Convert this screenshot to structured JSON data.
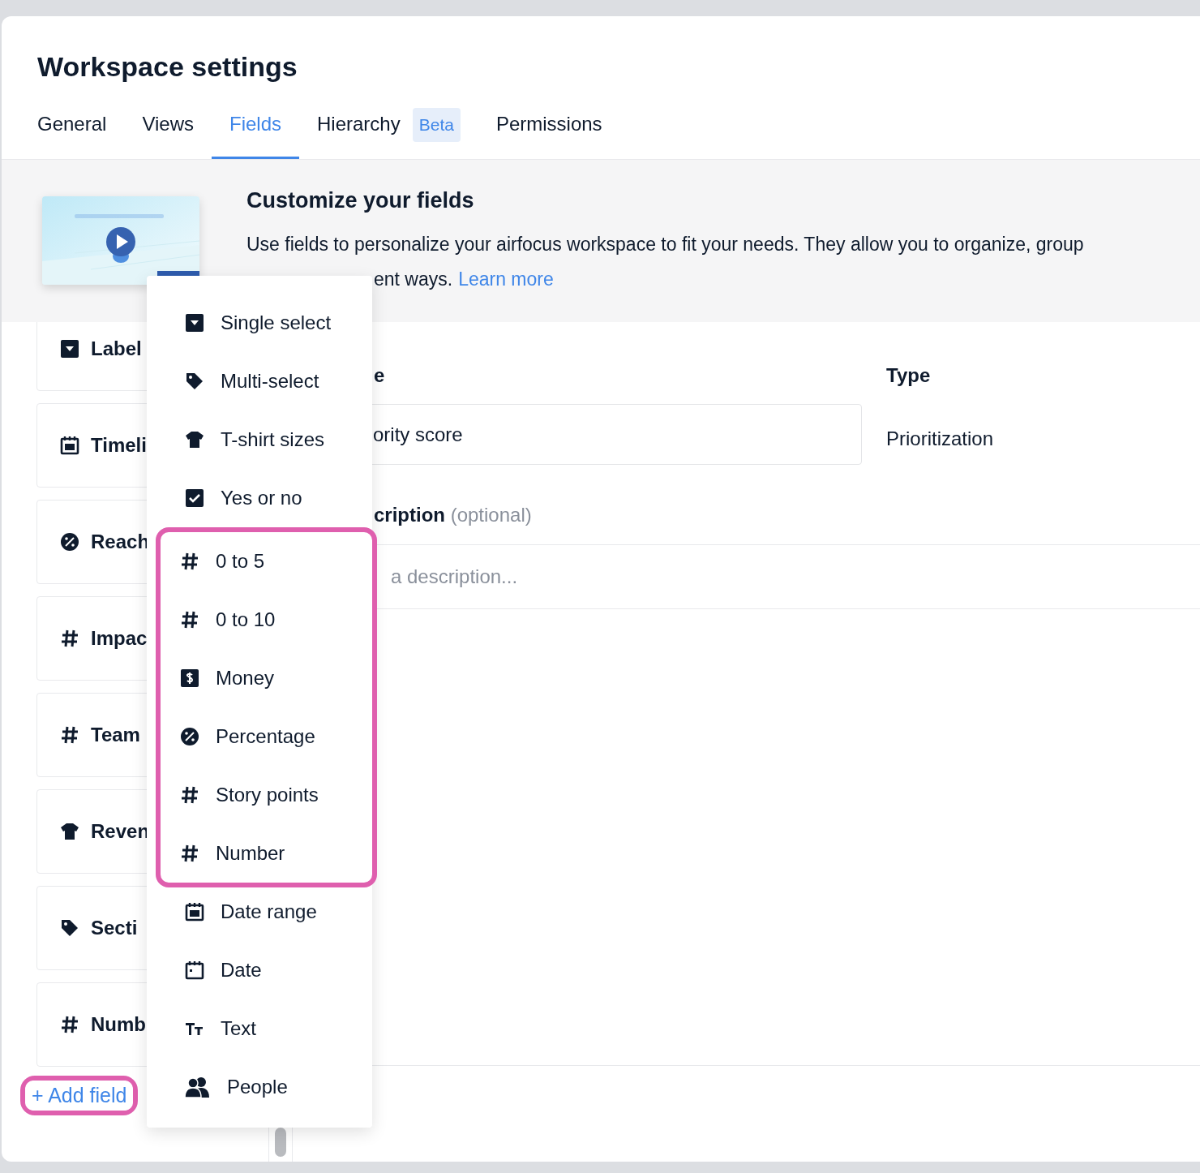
{
  "header": {
    "title": "Workspace settings"
  },
  "tabs": [
    {
      "label": "General",
      "selected": false
    },
    {
      "label": "Views",
      "selected": false
    },
    {
      "label": "Fields",
      "selected": true
    },
    {
      "label": "Hierarchy",
      "selected": false,
      "badge": "Beta"
    },
    {
      "label": "Permissions",
      "selected": false
    }
  ],
  "intro": {
    "title": "Customize your fields",
    "text_line_1": "Use fields to personalize your airfocus workspace to fit your needs. They allow you to organize, group",
    "text_line_2": "ent ways.",
    "link": "Learn more"
  },
  "field_list": [
    {
      "name": "Label",
      "kind": "select"
    },
    {
      "name": "Timeli",
      "kind": "daterange"
    },
    {
      "name": "Reach",
      "kind": "percent"
    },
    {
      "name": "Impac",
      "kind": "number"
    },
    {
      "name": "Team",
      "kind": "number"
    },
    {
      "name": "Reven",
      "kind": "tshirt"
    },
    {
      "name": "Secti",
      "kind": "tag"
    },
    {
      "name": "Numb",
      "kind": "number"
    }
  ],
  "add_field": {
    "label": "+ Add field",
    "highlighted": true
  },
  "editor": {
    "name_label": "e",
    "name_value": "ority score",
    "type_label": "Type",
    "type_value": "Prioritization",
    "description_label": "cription",
    "description_hint": "(optional)",
    "description_placeholder": "a description..."
  },
  "type_menu": {
    "sections": [
      {
        "highlighted": false,
        "items": [
          {
            "label": "Single select",
            "kind": "select"
          },
          {
            "label": "Multi-select",
            "kind": "tag"
          },
          {
            "label": "T-shirt sizes",
            "kind": "tshirt"
          },
          {
            "label": "Yes or no",
            "kind": "checkbox"
          }
        ]
      },
      {
        "highlighted": true,
        "items": [
          {
            "label": "0 to 5",
            "kind": "number"
          },
          {
            "label": "0 to 10",
            "kind": "number"
          },
          {
            "label": "Money",
            "kind": "money"
          },
          {
            "label": "Percentage",
            "kind": "percent"
          },
          {
            "label": "Story points",
            "kind": "number"
          },
          {
            "label": "Number",
            "kind": "number"
          }
        ]
      },
      {
        "highlighted": false,
        "items": [
          {
            "label": "Date range",
            "kind": "daterange"
          },
          {
            "label": "Date",
            "kind": "date"
          },
          {
            "label": "Text",
            "kind": "text"
          },
          {
            "label": "People",
            "kind": "people"
          }
        ]
      }
    ]
  }
}
